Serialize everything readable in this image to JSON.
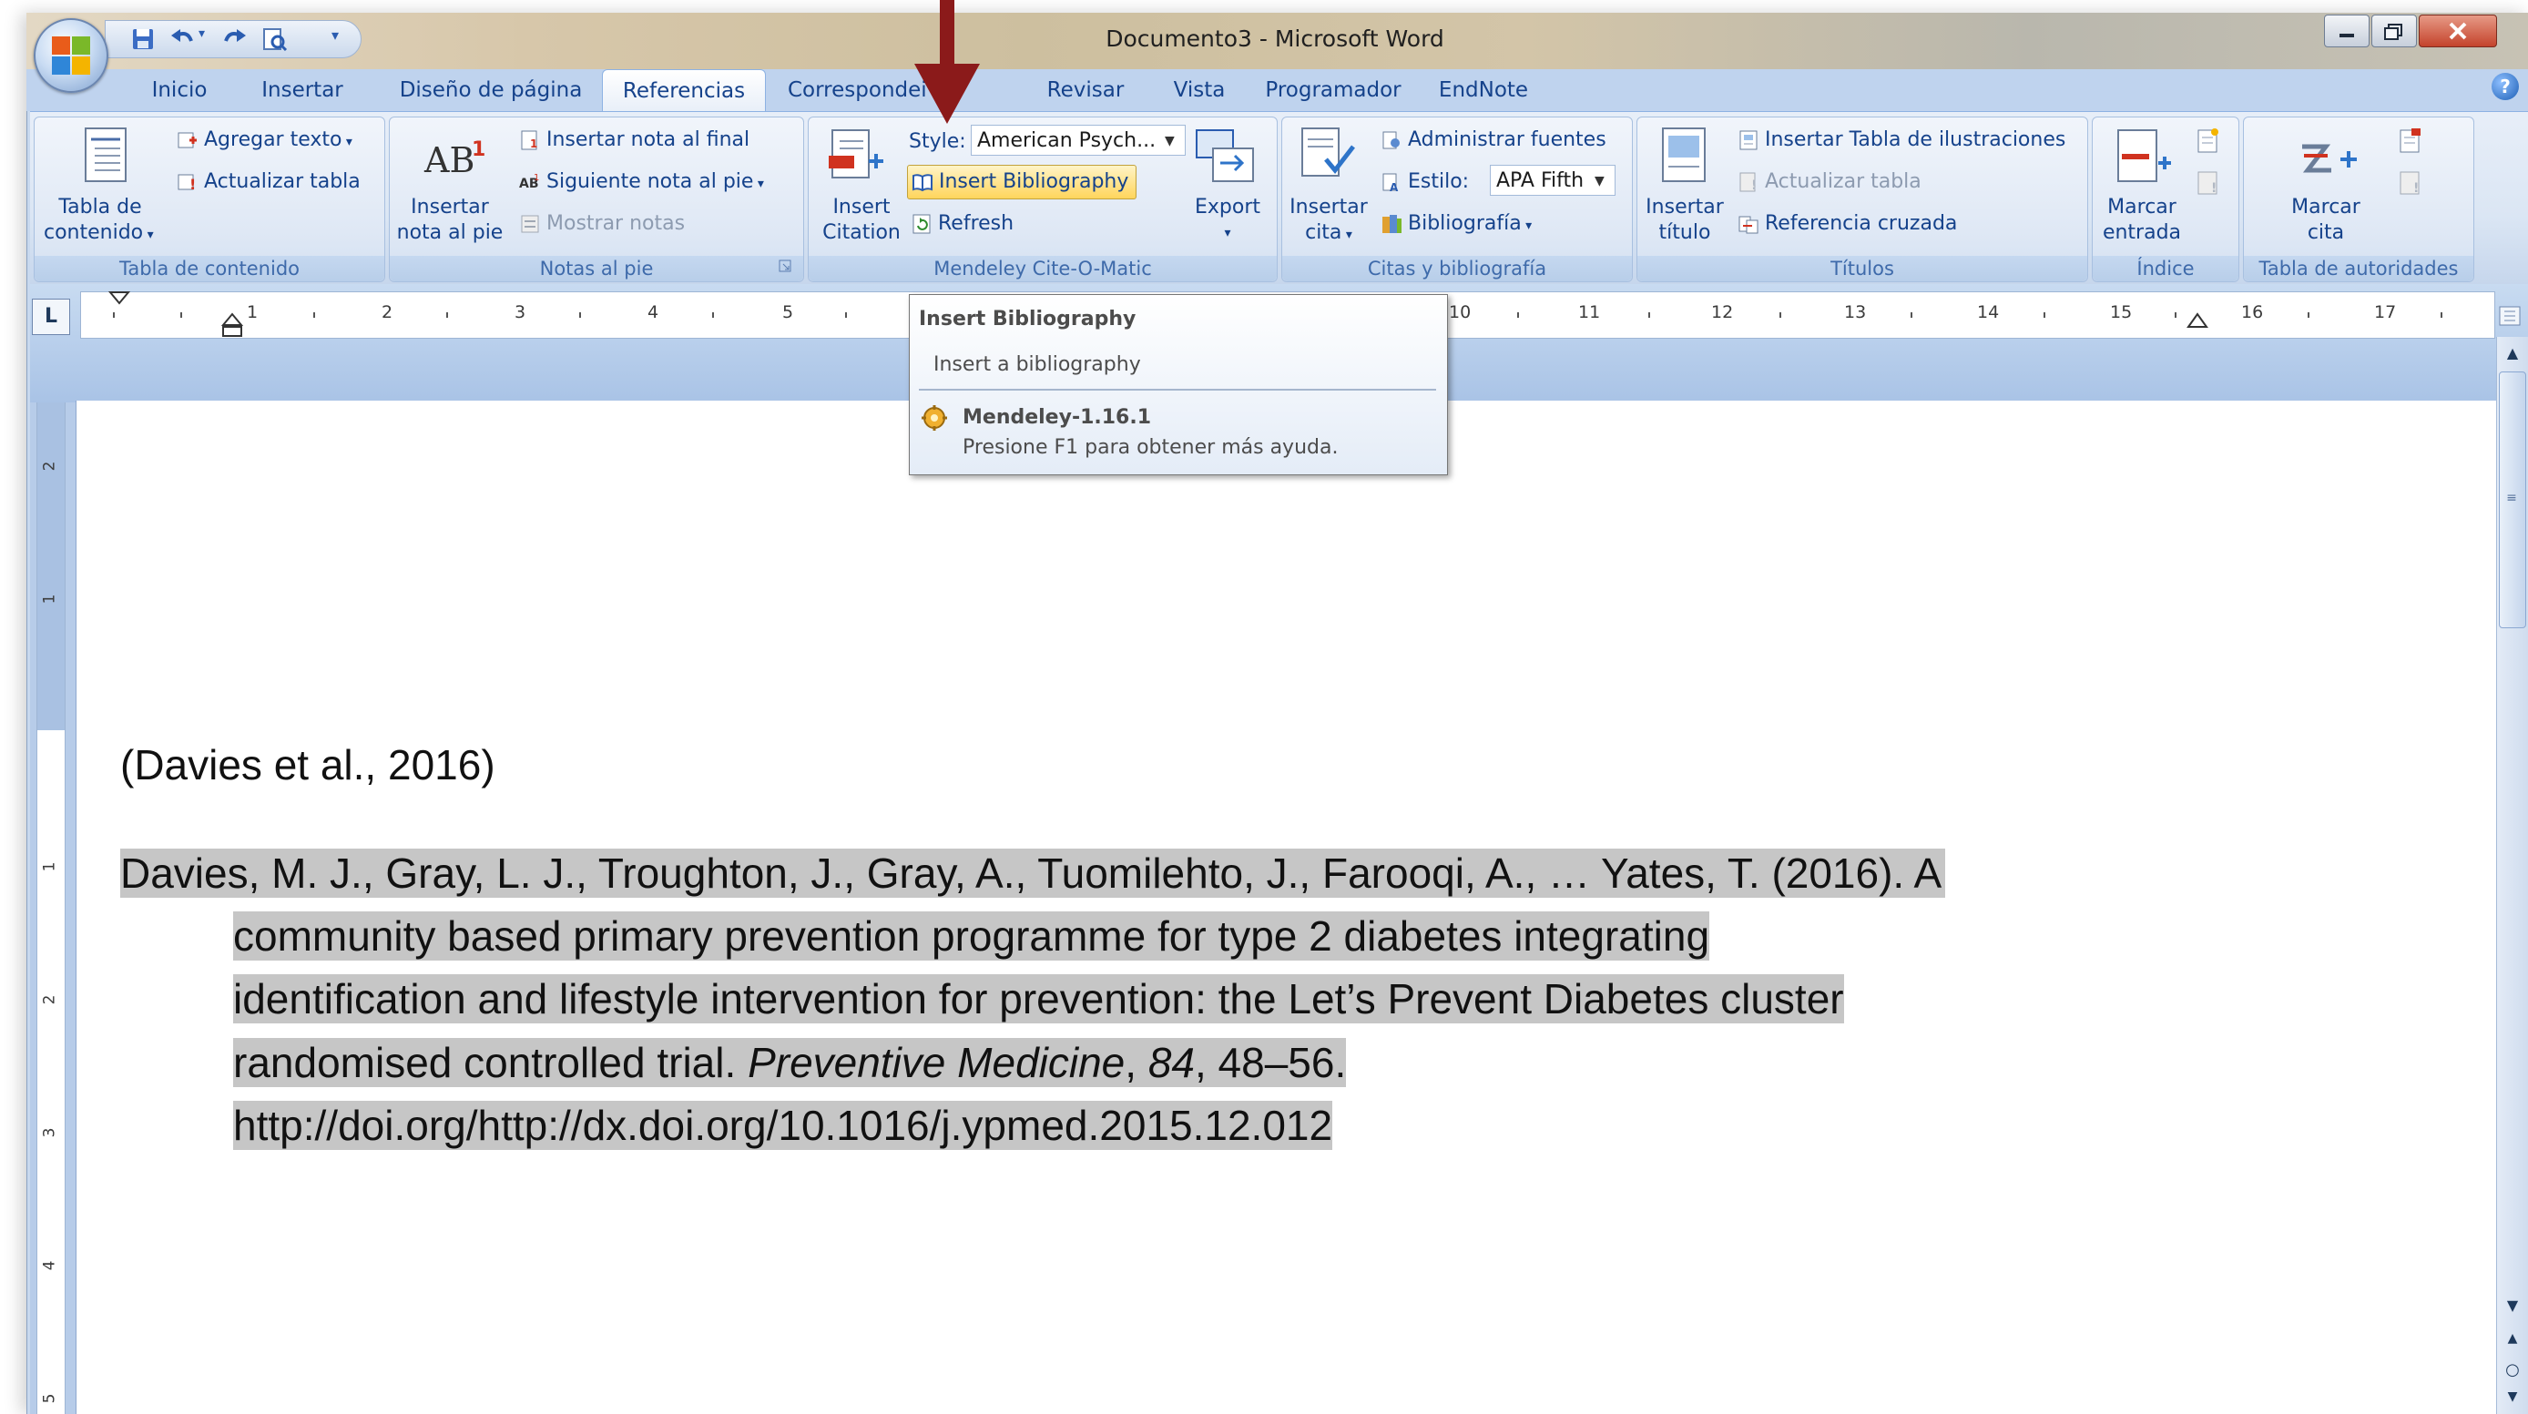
{
  "window": {
    "title": "Documento3 - Microsoft Word",
    "controls": [
      "minimize",
      "restore",
      "close"
    ]
  },
  "quick_access": {
    "icons": [
      "save-icon",
      "undo-icon",
      "redo-icon",
      "print-preview-icon",
      "customize-qat-icon"
    ]
  },
  "tabs": [
    "Inicio",
    "Insertar",
    "Diseño de página",
    "Referencias",
    "Correspondencia",
    "Revisar",
    "Vista",
    "Programador",
    "EndNote"
  ],
  "tabs_visible": [
    "Inicio",
    "Insertar",
    "Diseño de página",
    "Referencias",
    "Correspondei",
    "Revisar",
    "Vista",
    "Programador",
    "EndNote"
  ],
  "active_tab": "Referencias",
  "ribbon": {
    "toc": {
      "label": "Tabla de contenido",
      "big_button_line1": "Tabla de",
      "big_button_line2": "contenido",
      "add_text": "Agregar texto",
      "update_table": "Actualizar tabla"
    },
    "footnotes": {
      "label": "Notas al pie",
      "insert_footnote_line1": "Insertar",
      "insert_footnote_line2": "nota al pie",
      "insert_endnote": "Insertar nota al final",
      "next_footnote": "Siguiente nota al pie",
      "show_notes": "Mostrar notas"
    },
    "mendeley": {
      "label": "Mendeley Cite-O-Matic",
      "insert_citation_line1": "Insert",
      "insert_citation_line2": "Citation",
      "style_label": "Style:",
      "style_value": "American Psych...",
      "insert_bibliography": "Insert Bibliography",
      "refresh": "Refresh",
      "export": "Export"
    },
    "citations": {
      "label": "Citas y bibliografía",
      "insert_citation_line1": "Insertar",
      "insert_citation_line2": "cita",
      "manage_sources": "Administrar fuentes",
      "style_label": "Estilo:",
      "style_value": "APA Fifth",
      "bibliography": "Bibliografía"
    },
    "captions": {
      "label": "Títulos",
      "insert_caption_line1": "Insertar",
      "insert_caption_line2": "título",
      "insert_table_figures": "Insertar Tabla de ilustraciones",
      "update_table": "Actualizar tabla",
      "cross_reference": "Referencia cruzada"
    },
    "index": {
      "label": "Índice",
      "mark_entry_line1": "Marcar",
      "mark_entry_line2": "entrada"
    },
    "authorities": {
      "label": "Tabla de autoridades",
      "mark_citation_line1": "Marcar",
      "mark_citation_line2": "cita"
    }
  },
  "ruler": {
    "ticks": [
      "1",
      "2",
      "3",
      "4",
      "5",
      "10",
      "11",
      "12",
      "13",
      "14",
      "15",
      "16",
      "17"
    ],
    "tab_selector": "L",
    "vertical_ticks": [
      "2",
      "1",
      "1",
      "2",
      "3",
      "4",
      "5"
    ]
  },
  "tooltip": {
    "title": "Insert Bibliography",
    "description": "Insert a bibliography",
    "addin": "Mendeley-1.16.1",
    "help": "Presione F1 para obtener más ayuda."
  },
  "document": {
    "citation": "(Davies et al., 2016)",
    "reference_line1": "Davies, M. J., Gray, L. J., Troughton, J., Gray, A., Tuomilehto, J., Farooqi, A., … Yates, T. (2016). A",
    "reference_line2": "community based primary prevention programme for type 2 diabetes integrating",
    "reference_line3": "identification and lifestyle intervention for prevention: the Let’s Prevent Diabetes cluster",
    "reference_line4_plain": "randomised controlled trial. ",
    "reference_journal": "Preventive Medicine",
    "reference_sep": ", ",
    "reference_volume": "84",
    "reference_pages": ", 48–56.",
    "reference_line5": "http://doi.org/http://dx.doi.org/10.1016/j.ypmed.2015.12.012"
  },
  "colors": {
    "highlight": "#c6c6c6",
    "annotation_arrow": "#8b1a1a",
    "ribbon_text": "#15428b"
  }
}
